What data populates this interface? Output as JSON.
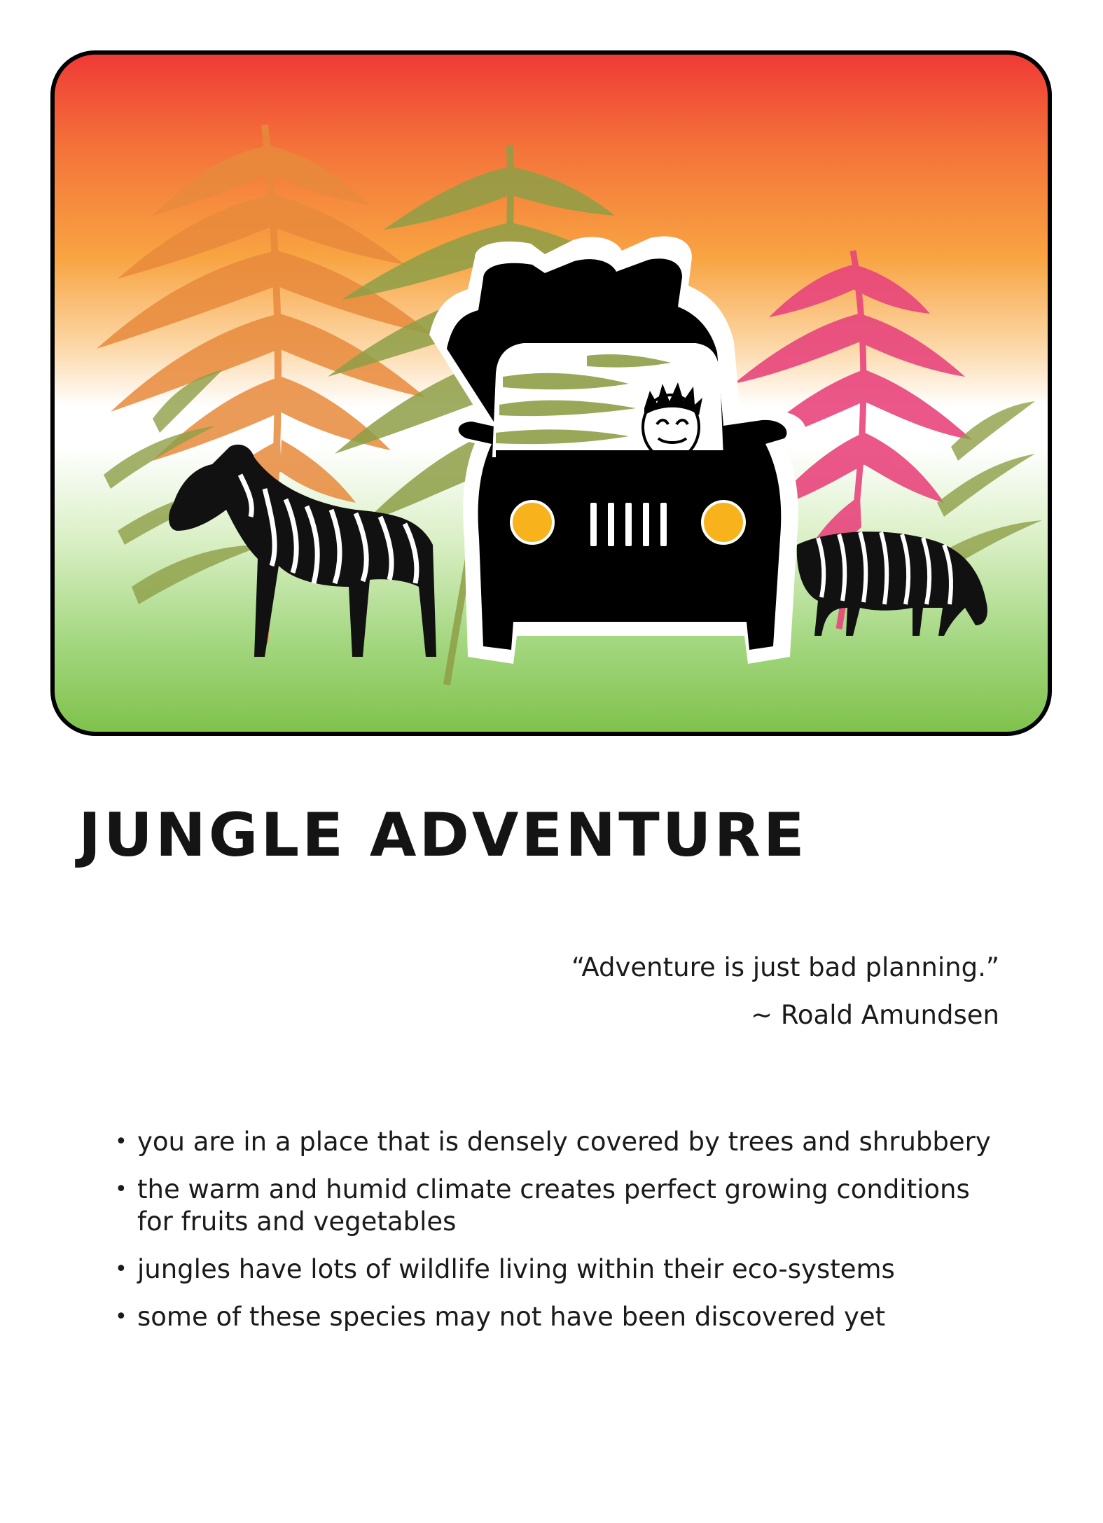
{
  "title": "JUNGLE ADVENTURE",
  "quote": {
    "text": "“Adventure is just bad planning.”",
    "author": "~ Roald Amundsen"
  },
  "facts": [
    "you are in a place that is densely covered by trees and shrubbery",
    "the warm and humid climate creates perfect growing conditions for fruits and vegetables",
    "jungles have lots of wildlife living within their eco-systems",
    "some of these species may not have been discovered yet"
  ],
  "illustration": {
    "colors": {
      "sky_top": "#ef3a36",
      "sky_mid": "#f8a442",
      "ground": "#7fc24b",
      "fern_orange": "#e88a3c",
      "fern_green": "#8e9f47",
      "fern_pink": "#e8457c",
      "jeep": "#000000",
      "headlight": "#f7b21c"
    },
    "elements": [
      "fern-icon",
      "zebra-icon",
      "jeep-icon",
      "driver-icon"
    ]
  }
}
